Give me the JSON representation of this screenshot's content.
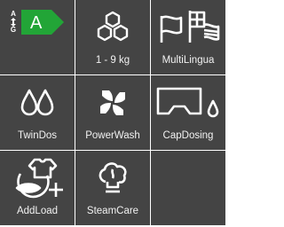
{
  "features": [
    {
      "icon": "energy-class-icon",
      "class_scale_top": "A",
      "class_scale_bottom": "G",
      "class_value": "A",
      "label": ""
    },
    {
      "icon": "drum-capacity-icon",
      "label": "1 - 9 kg"
    },
    {
      "icon": "multilingual-flags-icon",
      "label": "MultiLingua"
    },
    {
      "icon": "twindos-drops-icon",
      "label": "TwinDos"
    },
    {
      "icon": "powerwash-icon",
      "label": "PowerWash"
    },
    {
      "icon": "capdosing-icon",
      "label": "CapDosing"
    },
    {
      "icon": "addload-shirt-icon",
      "label": "AddLoad"
    },
    {
      "icon": "steamcare-icon",
      "label": "SteamCare"
    },
    {
      "icon": "",
      "label": ""
    }
  ],
  "colors": {
    "tile_background": "#444444",
    "energy_class_green": "#22a537",
    "icon_color": "#ffffff"
  }
}
